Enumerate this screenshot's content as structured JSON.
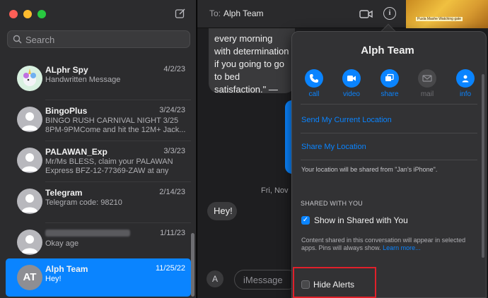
{
  "window": {
    "traffic_lights": [
      "#ff5f57",
      "#febc2e",
      "#28c840"
    ]
  },
  "search": {
    "placeholder": "Search"
  },
  "conversations": [
    {
      "name": "ALphr Spy",
      "date": "4/2/23",
      "preview": "Handwritten Message",
      "avatar": "unicorn-avatar"
    },
    {
      "name": "BingoPlus",
      "date": "3/24/23",
      "preview": "BINGO RUSH CARNIVAL NIGHT 3/25 8PM-9PMCome and hit the 12M+ Jack..."
    },
    {
      "name": "PALAWAN_Exp",
      "date": "3/3/23",
      "preview": "Mr/Ms BLESS, claim your PALAWAN Express BFZ-12-77369-ZAW at any Pal..."
    },
    {
      "name": "Telegram",
      "date": "2/14/23",
      "preview": "Telegram code: 98210"
    },
    {
      "name": "",
      "date": "1/11/23",
      "preview": "Okay age",
      "name_blurred": true
    },
    {
      "name": "Alph Team",
      "date": "11/25/22",
      "preview": "Hey!",
      "initials": "AT",
      "selected": true
    }
  ],
  "header": {
    "to_label": "To:",
    "recipient": "Alph Team"
  },
  "chat": {
    "quote_text": "every morning with determination if you going to go to bed satisfaction.\" —Geo Lorimer",
    "day_stamp": "Fri, Nov",
    "message": "Hey!",
    "input_placeholder": "iMessage"
  },
  "details": {
    "title": "Alph Team",
    "actions": [
      {
        "label": "call",
        "icon": "phone-icon",
        "enabled": true
      },
      {
        "label": "video",
        "icon": "video-icon",
        "enabled": true
      },
      {
        "label": "share",
        "icon": "share-screen-icon",
        "enabled": true
      },
      {
        "label": "mail",
        "icon": "mail-icon",
        "enabled": false
      },
      {
        "label": "info",
        "icon": "person-icon",
        "enabled": true
      }
    ],
    "send_location": "Send My Current Location",
    "share_location": "Share My Location",
    "location_note": "Your location will be shared from \"Jan's iPhone\".",
    "shared_header": "SHARED WITH YOU",
    "show_in_shared": "Show in Shared with You",
    "show_in_shared_checked": true,
    "shared_note": "Content shared in this conversation will appear in selected apps. Pins will always show.",
    "learn_more": "Learn more...",
    "hide_alerts": "Hide Alerts",
    "hide_alerts_checked": false
  },
  "thumbnail_caption": "Pusla Mashe Watching gate"
}
